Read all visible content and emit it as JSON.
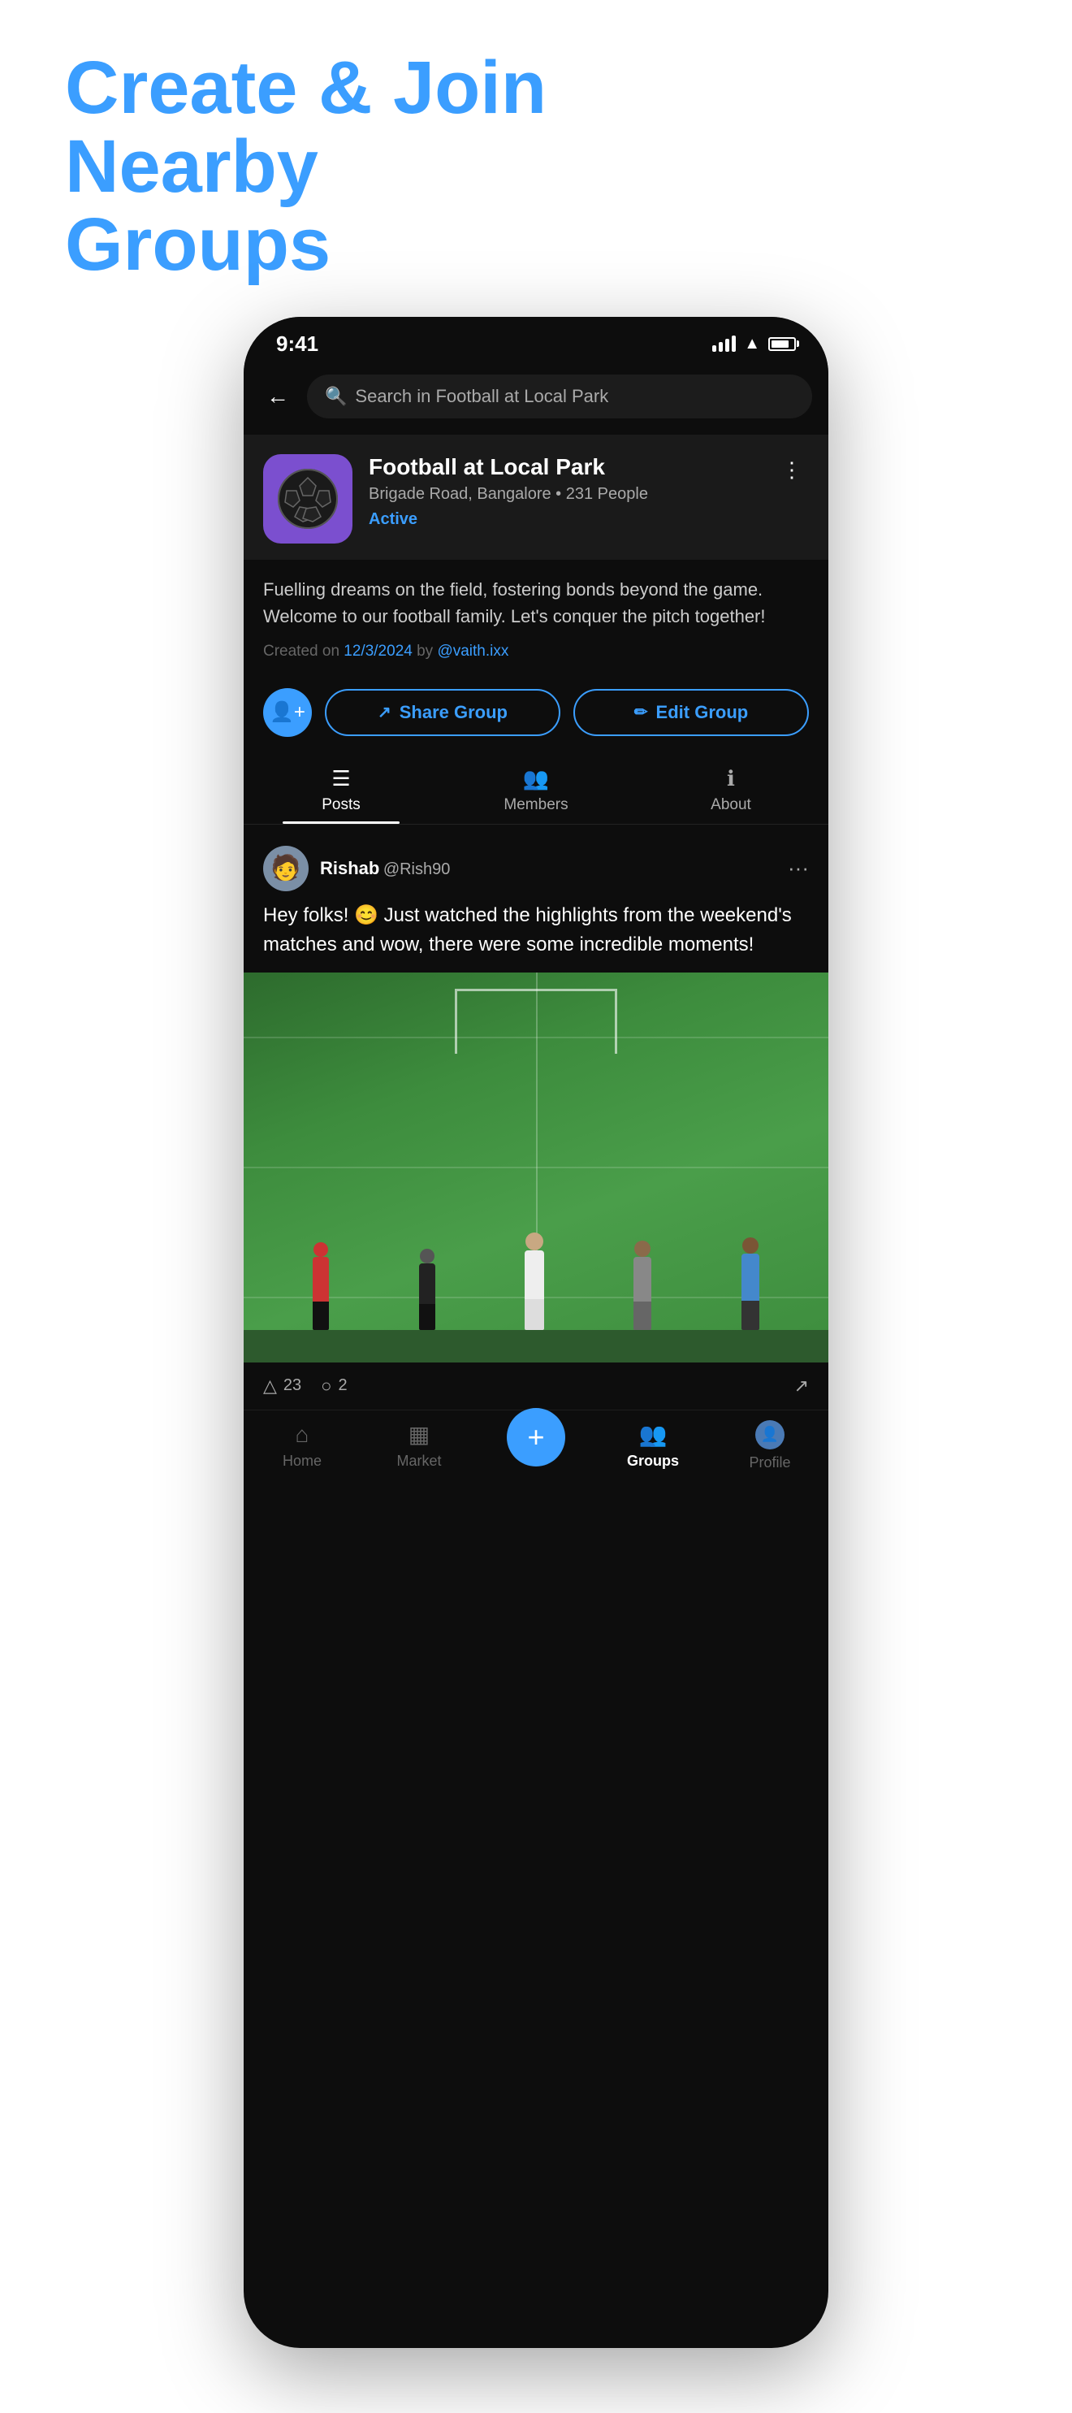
{
  "header": {
    "line1": "Create & Join",
    "line2": "Nearby ",
    "highlight": "Groups"
  },
  "statusBar": {
    "time": "9:41"
  },
  "search": {
    "placeholder": "Search in Football at Local Park"
  },
  "group": {
    "name": "Football at Local Park",
    "location": "Brigade Road, Bangalore",
    "memberCount": "231 People",
    "status": "Active",
    "description": "Fuelling dreams on the field, fostering bonds beyond the game. Welcome to our football family. Let's conquer the pitch together!",
    "createdDate": "12/3/2024",
    "createdBy": "@vaith.ixx"
  },
  "actions": {
    "shareLabel": "Share Group",
    "editLabel": "Edit Group"
  },
  "tabs": {
    "posts": "Posts",
    "members": "Members",
    "about": "About"
  },
  "post": {
    "username": "Rishab",
    "handle": "@Rish90",
    "text": "Hey folks! 😊 Just watched the highlights from the weekend's matches and wow, there were some incredible moments!",
    "likes": "23",
    "comments": "2"
  },
  "bottomNav": {
    "home": "Home",
    "market": "Market",
    "groups": "Groups",
    "profile": "Profile"
  }
}
